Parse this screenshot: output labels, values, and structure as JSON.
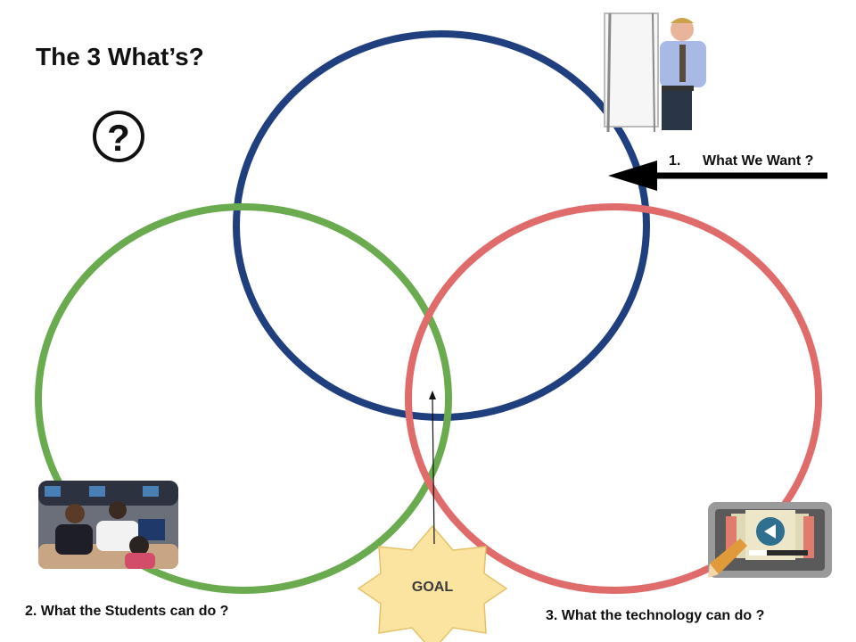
{
  "title": "The 3 What’s?",
  "icons": {
    "question": "question-circle-icon",
    "teacher": "teacher-whiteboard-image",
    "students": "students-photo",
    "technology": "tablet-video-icon"
  },
  "circles": [
    {
      "name": "What We Want",
      "color": "#1f3f7f"
    },
    {
      "name": "What the Students can do",
      "color": "#6aab4f"
    },
    {
      "name": "What the technology can do",
      "color": "#e06b6b"
    }
  ],
  "labels": {
    "want_num": "1.",
    "want_text": "What We Want ?",
    "students": "2. What the Students can do ?",
    "technology": "3. What the technology can do ?"
  },
  "goal": {
    "label": "GOAL",
    "fill": "#fbe3a0"
  }
}
